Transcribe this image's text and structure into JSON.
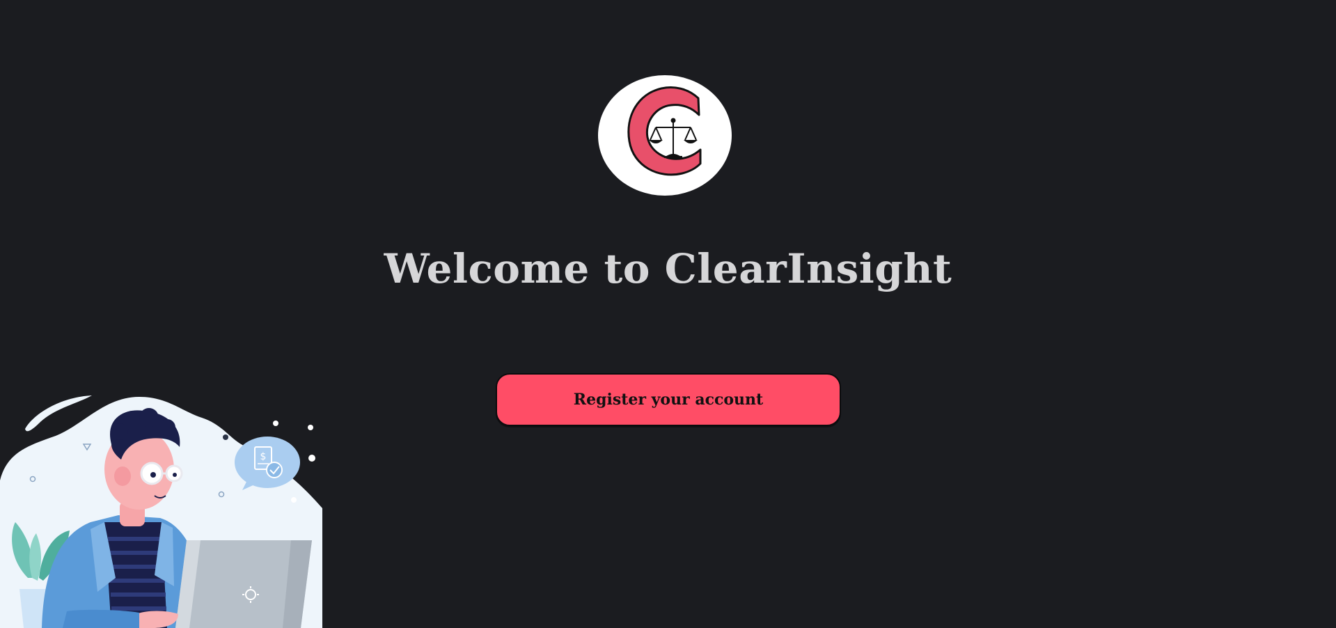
{
  "brand": {
    "logo_icon": "scales-of-justice-c-logo",
    "accent_color": "#ff4d66",
    "background_color": "#1b1c20"
  },
  "main": {
    "title": "Welcome to ClearInsight",
    "register_label": "Register your account"
  },
  "illustration": {
    "icon": "person-at-laptop-illustration",
    "bubble_symbol": "$"
  }
}
